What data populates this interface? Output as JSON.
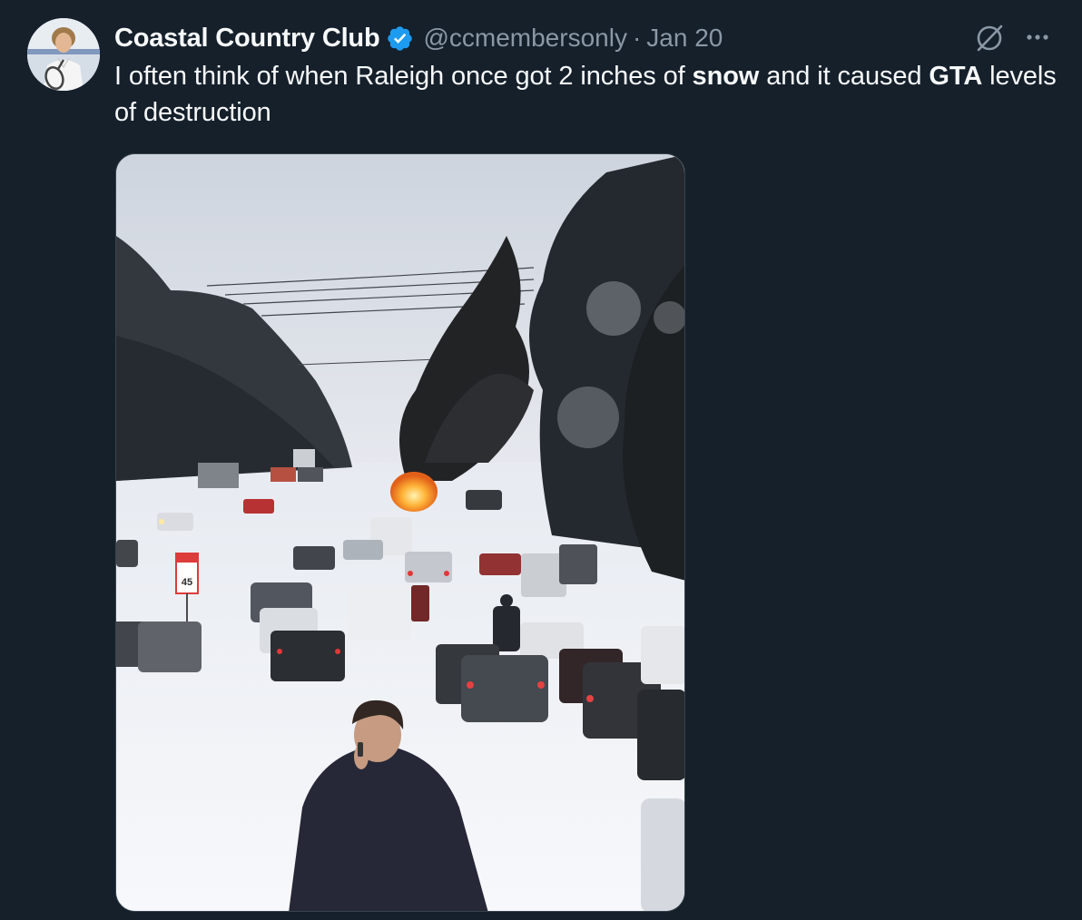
{
  "tweet": {
    "author": {
      "display_name": "Coastal Country Club",
      "verified_icon": "verified-badge-icon",
      "handle": "@ccmembersonly",
      "separator": "·",
      "date": "Jan 20"
    },
    "actions": {
      "grok_icon": "grok-icon",
      "more_icon": "more-horizontal-icon"
    },
    "text": {
      "part1": "I often think of when Raleigh once got 2 inches of ",
      "bold1": "snow",
      "part2": " and it caused ",
      "bold2": "GTA",
      "part3": " levels of destruction"
    },
    "media": {
      "kind": "photo",
      "sign_text": "45"
    }
  },
  "colors": {
    "background": "#15202b",
    "primary_text": "#f7f9f9",
    "secondary_text": "#8b98a5",
    "verified": "#1d9bf0",
    "border": "#38444d"
  }
}
